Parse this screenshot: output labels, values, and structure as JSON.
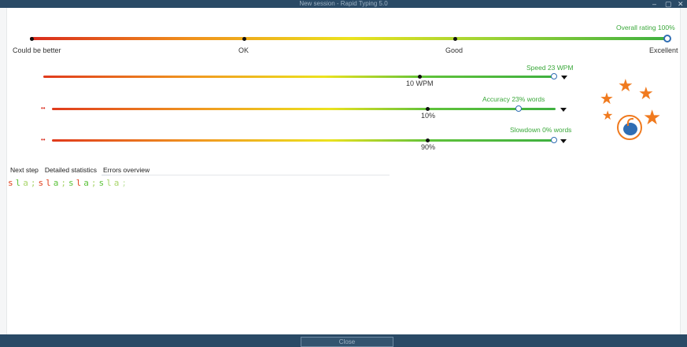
{
  "window": {
    "title": "New session - Rapid Typing 5.0",
    "controls": [
      "–",
      "▢",
      "✕"
    ]
  },
  "overall": {
    "label": "Overall rating 100%",
    "value_percent": 100,
    "scale": [
      "Could be better",
      "OK",
      "Good",
      "Excellent"
    ]
  },
  "metrics": [
    {
      "label": "Speed 23 WPM",
      "tick": "10 WPM",
      "value_fraction": 0.94,
      "marker": ""
    },
    {
      "label": "Accuracy 23% words",
      "tick": "10%",
      "value_fraction": 0.85,
      "marker": "••"
    },
    {
      "label": "Slowdown 0% words",
      "tick": "90%",
      "value_fraction": 0.94,
      "marker": "••"
    }
  ],
  "tabs": [
    "Next step",
    "Detailed statistics",
    "Errors overview"
  ],
  "active_tab": 2,
  "keys": [
    {
      "ch": "s",
      "state": "err"
    },
    {
      "ch": "l",
      "state": "ok"
    },
    {
      "ch": "a",
      "state": "mid"
    },
    {
      "ch": ";",
      "state": "mid"
    },
    {
      "ch": "s",
      "state": "err"
    },
    {
      "ch": "l",
      "state": "err"
    },
    {
      "ch": "a",
      "state": "ok"
    },
    {
      "ch": ";",
      "state": "mid"
    },
    {
      "ch": "s",
      "state": "ok"
    },
    {
      "ch": "l",
      "state": "err"
    },
    {
      "ch": "a",
      "state": "ok"
    },
    {
      "ch": ";",
      "state": "mid"
    },
    {
      "ch": "s",
      "state": "ok"
    },
    {
      "ch": "l",
      "state": "mid"
    },
    {
      "ch": "a",
      "state": "mid"
    },
    {
      "ch": ";",
      "state": "faint"
    }
  ],
  "footer": {
    "close_label": "Close"
  },
  "colors": {
    "accent": "#3aa83a",
    "error": "#e0401c",
    "star": "#f07a1e",
    "frame": "#2a4a66"
  }
}
